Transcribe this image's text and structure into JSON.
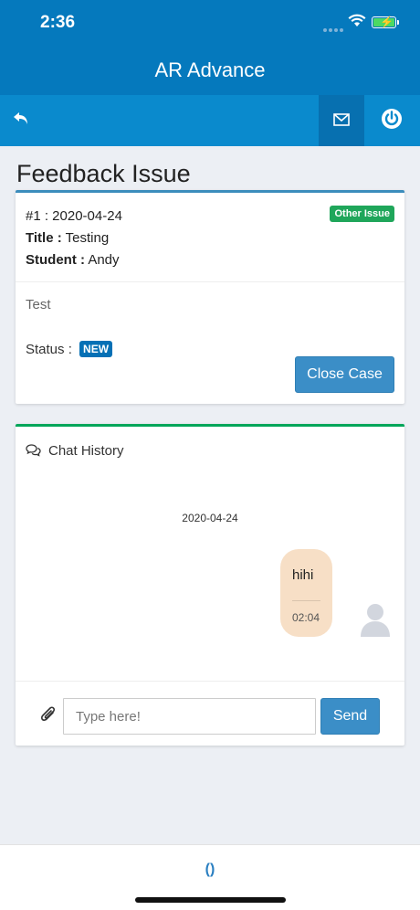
{
  "status_bar": {
    "time": "2:36"
  },
  "app": {
    "title": "AR Advance"
  },
  "toolbar": {
    "back_icon": "reply-icon",
    "mail_icon": "envelope-icon",
    "power_icon": "power-icon"
  },
  "page": {
    "title": "Feedback Issue"
  },
  "issue": {
    "id_date": "#1 : 2020-04-24",
    "category_badge": "Other Issue",
    "title_label": "Title :",
    "title_value": " Testing",
    "student_label": "Student :",
    "student_value": " Andy",
    "description": "Test",
    "status_label": "Status :",
    "status_badge": "NEW",
    "close_button": "Close Case"
  },
  "chat": {
    "header": "Chat History",
    "date": "2020-04-24",
    "messages": [
      {
        "text": "hihi",
        "time": "02:04"
      }
    ],
    "input_placeholder": "Type here!",
    "send_button": "Send"
  },
  "bottom": {
    "loader": "()"
  },
  "colors": {
    "primary": "#0579bd",
    "toolbar": "#0a8acd",
    "success": "#00a65a",
    "info": "#3c8dbc",
    "bubble": "#f7dfc6"
  }
}
